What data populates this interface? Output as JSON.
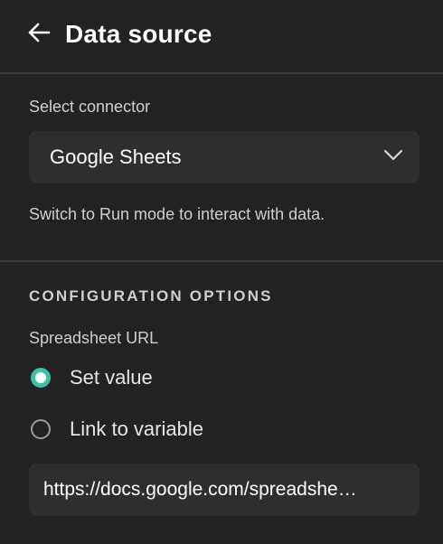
{
  "header": {
    "title": "Data source",
    "back_icon": "arrow-left-icon"
  },
  "connector": {
    "label": "Select connector",
    "selected": "Google Sheets",
    "dropdown_icon": "chevron-down-icon",
    "hint": "Switch to Run mode to interact with data."
  },
  "config": {
    "heading": "CONFIGURATION OPTIONS",
    "field_label": "Spreadsheet URL",
    "options": [
      {
        "label": "Set value",
        "checked": true
      },
      {
        "label": "Link to variable",
        "checked": false
      }
    ],
    "url_value": "https://docs.google.com/spreadshe…"
  },
  "colors": {
    "background": "#222222",
    "input_bg": "#2e2e2e",
    "accent": "#3fbfa6",
    "divider": "#3a3a3a"
  }
}
